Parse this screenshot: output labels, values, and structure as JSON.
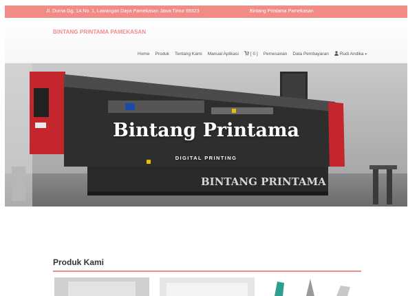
{
  "topbar": {
    "address": "Jl. Durna Gg. 1A No. 1, Lawangan Daya Pamekasan Jawa Timur 69323",
    "brand": "Bintang Printama Pamekasan"
  },
  "header": {
    "logo": "BINTANG PRINTAMA PAMEKASAN",
    "nav": {
      "home": "Home",
      "produk": "Produk",
      "tentang": "Tentang Kami",
      "manual": "Manual Aplikasi",
      "cart": "[ 0 ]",
      "pemesanan": "Pemesanan",
      "pembayaran": "Data Pembayaran",
      "user": "Rudi Andika"
    }
  },
  "hero": {
    "title": "Bintang Printama",
    "subtitle": "DIGITAL PRINTING",
    "machine_label": "BINTANG PRINTAMA"
  },
  "products": {
    "title": "Produk Kami",
    "accent": "#f08b86"
  }
}
